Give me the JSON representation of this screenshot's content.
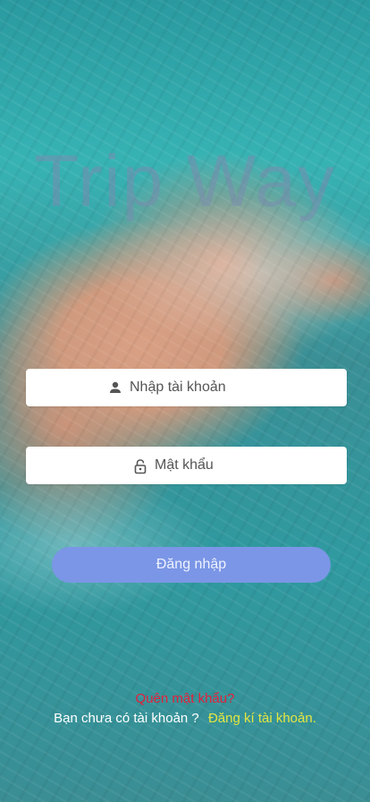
{
  "brand": {
    "title": "Trip Way"
  },
  "login": {
    "username_placeholder": "Nhập tài khoản",
    "password_placeholder": "Mật khẩu",
    "submit_label": "Đăng nhập"
  },
  "footer": {
    "forgot_label": "Quên mật khẩu?",
    "no_account_text": "Bạn chưa có tài khoản ?",
    "signup_label": "Đăng kí tài khoản."
  },
  "icons": {
    "username": "person-icon",
    "password": "lock-icon"
  },
  "colors": {
    "button_bg": "#7b96e6",
    "forgot": "#e4203a",
    "signup_link": "#e2e641",
    "brand_text": "#788caf"
  }
}
